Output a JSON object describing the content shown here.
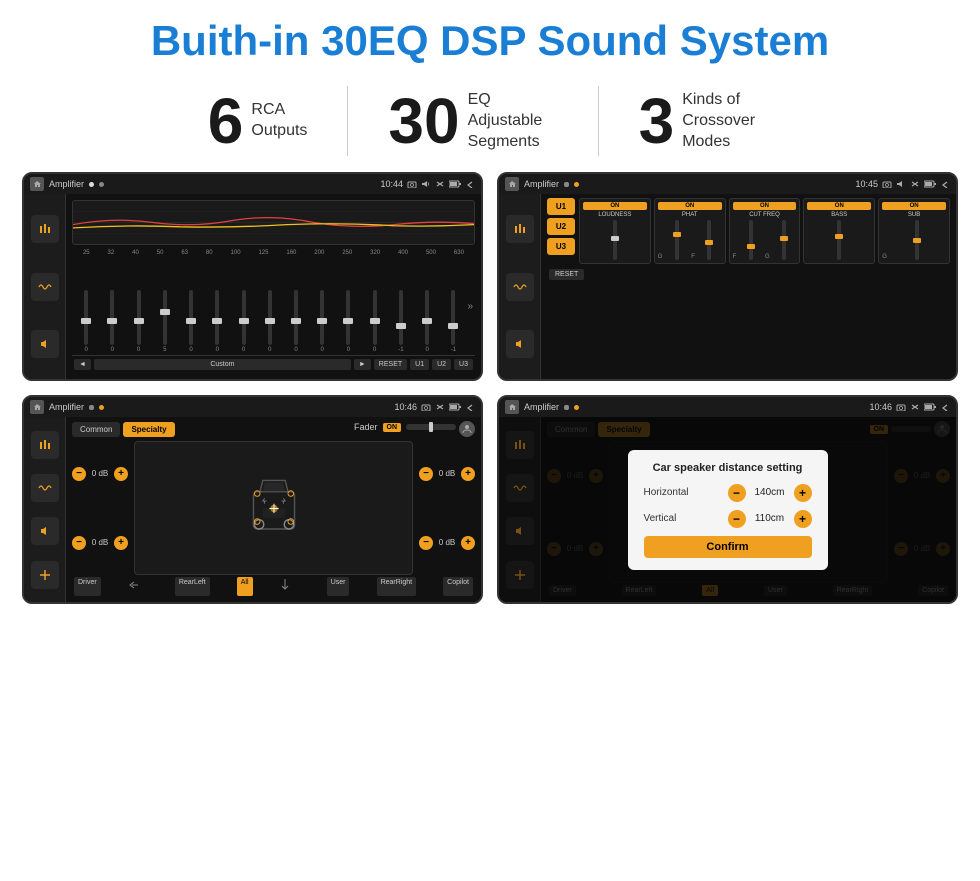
{
  "page": {
    "title": "Buith-in 30EQ DSP Sound System"
  },
  "stats": [
    {
      "number": "6",
      "label": "RCA\nOutputs"
    },
    {
      "number": "30",
      "label": "EQ Adjustable\nSegments"
    },
    {
      "number": "3",
      "label": "Kinds of\nCrossover Modes"
    }
  ],
  "screens": {
    "eq": {
      "title": "Amplifier",
      "time": "10:44",
      "freq_labels": [
        "25",
        "32",
        "40",
        "50",
        "63",
        "80",
        "100",
        "125",
        "160",
        "200",
        "250",
        "320",
        "400",
        "500",
        "630"
      ],
      "slider_values": [
        "0",
        "0",
        "0",
        "5",
        "0",
        "0",
        "0",
        "0",
        "0",
        "0",
        "0",
        "0",
        "-1",
        "0",
        "-1"
      ],
      "preset": "Custom",
      "buttons": [
        "◄",
        "►",
        "RESET",
        "U1",
        "U2",
        "U3"
      ]
    },
    "crossover": {
      "title": "Amplifier",
      "time": "10:45",
      "u_buttons": [
        "U1",
        "U2",
        "U3"
      ],
      "modules": [
        {
          "on": true,
          "label": "LOUDNESS"
        },
        {
          "on": true,
          "label": "PHAT"
        },
        {
          "on": true,
          "label": "CUT FREQ"
        },
        {
          "on": true,
          "label": "BASS"
        },
        {
          "on": true,
          "label": "SUB"
        }
      ],
      "reset_label": "RESET"
    },
    "fader": {
      "title": "Amplifier",
      "time": "10:46",
      "tabs": [
        "Common",
        "Specialty"
      ],
      "active_tab": "Specialty",
      "fader_label": "Fader",
      "fader_on": "ON",
      "db_left_top": "0 dB",
      "db_left_bottom": "0 dB",
      "db_right_top": "0 dB",
      "db_right_bottom": "0 dB",
      "bottom_labels": [
        "Driver",
        "",
        "RearLeft",
        "All",
        "",
        "User",
        "RearRight",
        "Copilot"
      ]
    },
    "dialog": {
      "title": "Amplifier",
      "time": "10:46",
      "tabs": [
        "Common",
        "Specialty"
      ],
      "dialog_title": "Car speaker distance setting",
      "horizontal_label": "Horizontal",
      "horizontal_value": "140cm",
      "vertical_label": "Vertical",
      "vertical_value": "110cm",
      "confirm_label": "Confirm",
      "db_right_top": "0 dB",
      "db_right_bottom": "0 dB",
      "bottom_labels": [
        "Driver",
        "Copilot",
        "RearLeft",
        "All",
        "User",
        "RearRight"
      ]
    }
  }
}
